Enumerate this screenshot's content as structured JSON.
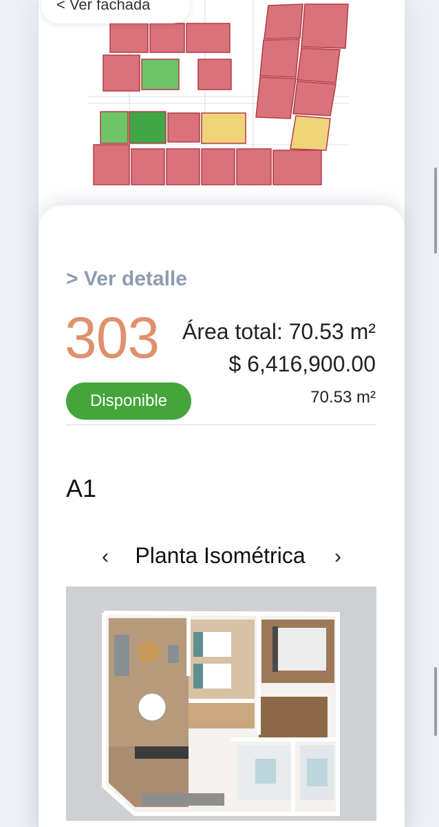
{
  "nav": {
    "back_label": "< Ver fachada"
  },
  "unit": {
    "detail_link": "> Ver detalle",
    "number": "303",
    "area_total": "Área total: 70.53 m²",
    "price": "$ 6,416,900.00",
    "status": "Disponible",
    "area": "70.53 m²",
    "model": "A1"
  },
  "view": {
    "prev_icon": "chevron-left-icon",
    "next_icon": "chevron-right-icon",
    "title": "Planta Isométrica"
  },
  "colors": {
    "sold": "#d9727a",
    "available": "#6ec466",
    "reserved": "#f0d47a",
    "accent_number": "#e0916c",
    "status_green": "#43a53a",
    "link_gray": "#8e9bb0"
  }
}
